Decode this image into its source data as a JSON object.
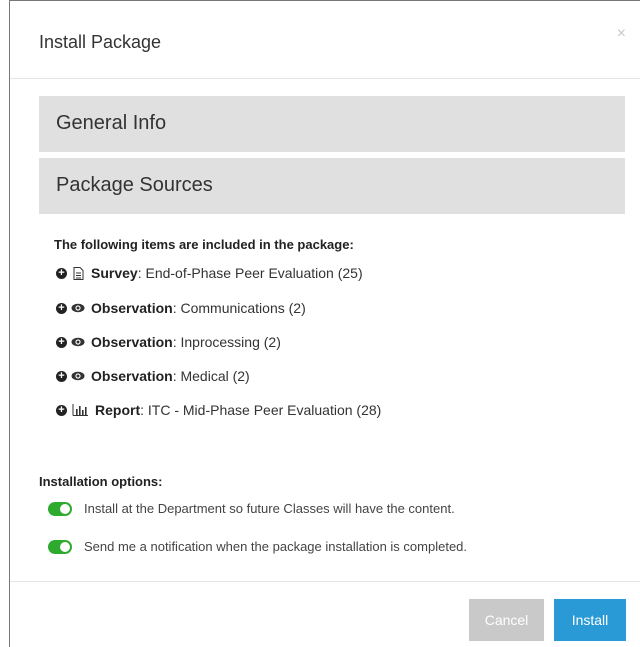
{
  "dialog": {
    "title": "Install Package",
    "close_symbol": "×"
  },
  "panels": {
    "general": "General Info",
    "sources": "Package Sources"
  },
  "items_title": "The following items are included in the package:",
  "items": [
    {
      "icon": "document-icon",
      "type": "Survey",
      "text": ": End-of-Phase Peer Evaluation (25)"
    },
    {
      "icon": "eye-icon",
      "type": "Observation",
      "text": ": Communications (2)"
    },
    {
      "icon": "eye-icon",
      "type": "Observation",
      "text": ": Inprocessing (2)"
    },
    {
      "icon": "eye-icon",
      "type": "Observation",
      "text": ": Medical (2)"
    },
    {
      "icon": "bar-chart-icon",
      "type": "Report",
      "text": ": ITC - Mid-Phase Peer Evaluation (28)"
    }
  ],
  "options_title": "Installation options:",
  "options": [
    {
      "label": "Install at the Department so future Classes will have the content.",
      "enabled": true
    },
    {
      "label": "Send me a notification when the package installation is completed.",
      "enabled": true
    }
  ],
  "buttons": {
    "cancel": "Cancel",
    "install": "Install"
  },
  "colors": {
    "toggle_on": "#2eaa2e",
    "install_button": "#2a9ad6",
    "cancel_button": "#c9c9c9",
    "panel_bg": "#e0e0e0"
  }
}
